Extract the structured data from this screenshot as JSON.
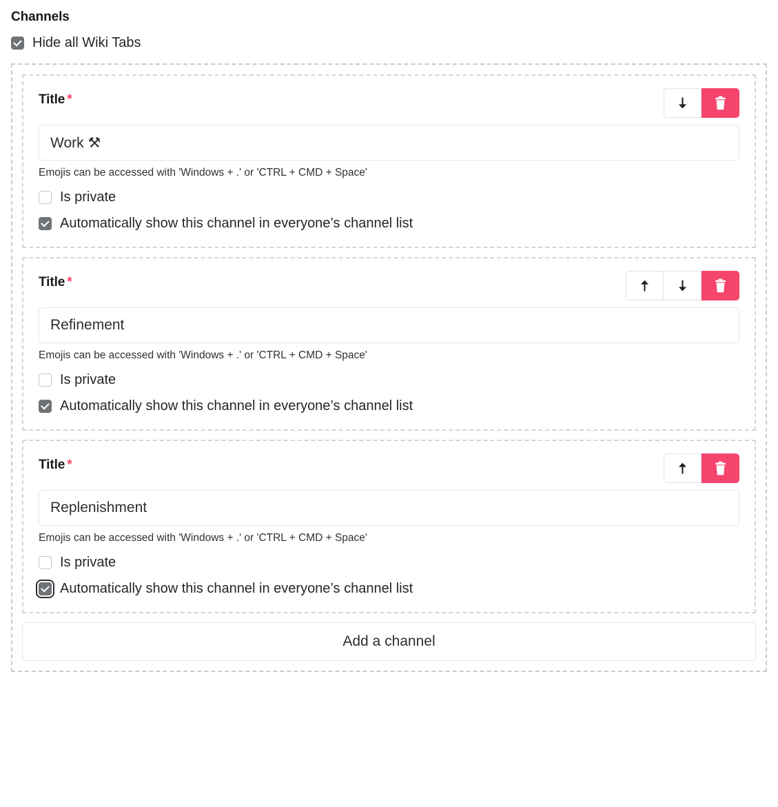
{
  "section": {
    "title": "Channels",
    "hide_wiki_tabs_label": "Hide all Wiki Tabs",
    "hide_wiki_tabs_checked": true
  },
  "labels": {
    "title_label": "Title",
    "required_marker": "*",
    "help_text": "Emojis can be accessed with 'Windows + .' or 'CTRL + CMD + Space'",
    "is_private_label": "Is private",
    "auto_show_label": "Automatically show this channel in everyone’s channel list",
    "move_up_icon": "arrow-up-icon",
    "move_down_icon": "arrow-down-icon",
    "delete_icon": "trash-icon"
  },
  "add_button": {
    "label": "Add a channel"
  },
  "colors": {
    "danger": "#f5456c",
    "required_asterisk": "#f5456c",
    "checkbox_checked": "#6f7376",
    "dashed_border": "#c9cbcd"
  },
  "channels": [
    {
      "title_value": "Work ⚒",
      "is_private": false,
      "auto_show": true,
      "auto_show_focused": false,
      "can_move_up": false,
      "can_move_down": true
    },
    {
      "title_value": "Refinement",
      "is_private": false,
      "auto_show": true,
      "auto_show_focused": false,
      "can_move_up": true,
      "can_move_down": true
    },
    {
      "title_value": "Replenishment",
      "is_private": false,
      "auto_show": true,
      "auto_show_focused": true,
      "can_move_up": true,
      "can_move_down": false
    }
  ]
}
